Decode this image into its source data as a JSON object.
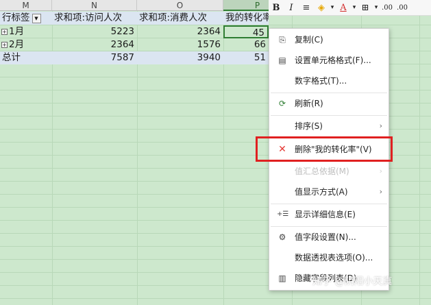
{
  "columns": [
    "M",
    "N",
    "O",
    "P"
  ],
  "pivot": {
    "header": [
      "行标签",
      "求和项:访问人次",
      "求和项:消费人次",
      "我的转化率"
    ],
    "rows": [
      {
        "label": "1月",
        "v1": "5223",
        "v2": "2364",
        "v3": "45"
      },
      {
        "label": "2月",
        "v1": "2364",
        "v2": "1576",
        "v3": "66"
      }
    ],
    "total": {
      "label": "总计",
      "v1": "7587",
      "v2": "3940",
      "v3": "51"
    }
  },
  "toolbar": {
    "bold": "B",
    "italic": "I",
    "align": "≡",
    "fill": "◈",
    "font_color": "A",
    "border": "⊞",
    "decimals": ".00"
  },
  "context_menu": {
    "items": [
      {
        "label": "复制(C)",
        "icon": "copy-icon",
        "glyph": "⎘",
        "disabled": false
      },
      {
        "label": "设置单元格格式(F)...",
        "icon": "format-cells-icon",
        "glyph": "▤",
        "disabled": false
      },
      {
        "label": "数字格式(T)...",
        "icon": "",
        "glyph": "",
        "disabled": false
      },
      {
        "label": "刷新(R)",
        "icon": "refresh-icon",
        "glyph": "⟳",
        "disabled": false
      },
      {
        "label": "排序(S)",
        "icon": "",
        "glyph": "",
        "disabled": false,
        "submenu": true
      },
      {
        "label": "删除\"我的转化率\"(V)",
        "icon": "delete-icon",
        "glyph": "✕",
        "disabled": false
      },
      {
        "label": "值汇总依据(M)",
        "icon": "",
        "glyph": "",
        "disabled": true,
        "submenu": true
      },
      {
        "label": "值显示方式(A)",
        "icon": "",
        "glyph": "",
        "disabled": false,
        "submenu": true
      },
      {
        "label": "显示详细信息(E)",
        "icon": "show-detail-icon",
        "glyph": "+☰",
        "disabled": false
      },
      {
        "label": "值字段设置(N)...",
        "icon": "field-settings-icon",
        "glyph": "⚙",
        "disabled": false
      },
      {
        "label": "数据透视表选项(O)...",
        "icon": "",
        "glyph": "",
        "disabled": false
      },
      {
        "label": "隐藏字段列表(D)",
        "icon": "field-list-icon",
        "glyph": "▥",
        "disabled": false
      }
    ],
    "submenu_arrow": "›"
  },
  "watermark": "知乎 @阴阳小天真",
  "colors": {
    "sheet_bg": "#cde8cd",
    "header_fill": "#dbe5f1",
    "highlight": "#e02020",
    "delete_icon": "#e53935"
  }
}
